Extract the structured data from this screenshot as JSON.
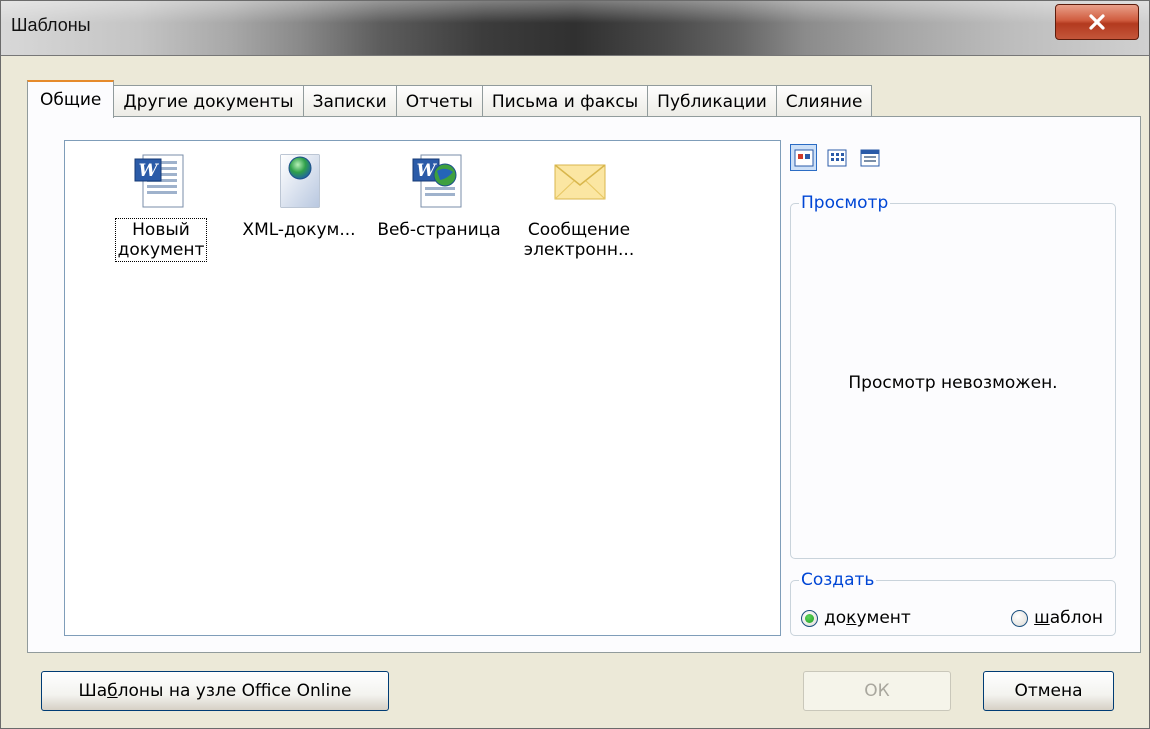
{
  "window": {
    "title": "Шаблоны"
  },
  "tabs": [
    {
      "label": "Общие",
      "active": true
    },
    {
      "label": "Другие документы"
    },
    {
      "label": "Записки"
    },
    {
      "label": "Отчеты"
    },
    {
      "label": "Письма и факсы"
    },
    {
      "label": "Публикации"
    },
    {
      "label": "Слияние"
    }
  ],
  "templates": [
    {
      "label": "Новый\nдокумент",
      "icon": "word-document-icon",
      "selected": true
    },
    {
      "label": "XML-докум...",
      "icon": "xml-document-icon"
    },
    {
      "label": "Веб-страница",
      "icon": "web-page-icon"
    },
    {
      "label": "Сообщение\nэлектронн...",
      "icon": "envelope-icon"
    }
  ],
  "view_buttons": [
    {
      "icon": "large-icons-view-icon",
      "active": true
    },
    {
      "icon": "list-view-icon"
    },
    {
      "icon": "details-view-icon"
    }
  ],
  "preview": {
    "legend": "Просмотр",
    "message": "Просмотр невозможен."
  },
  "create": {
    "legend": "Создать",
    "document_pre": "до",
    "document_u": "к",
    "document_post": "умент",
    "template_u": "ш",
    "template_post": "аблон",
    "selected": "document"
  },
  "buttons": {
    "online_pre": "Ша",
    "online_u": "б",
    "online_post": "лоны на узле Office Online",
    "ok": "ОК",
    "cancel": "Отмена"
  },
  "colors": {
    "accent_tab": "#e68b2c",
    "legend": "#0046d5",
    "close": "#c4563a"
  }
}
